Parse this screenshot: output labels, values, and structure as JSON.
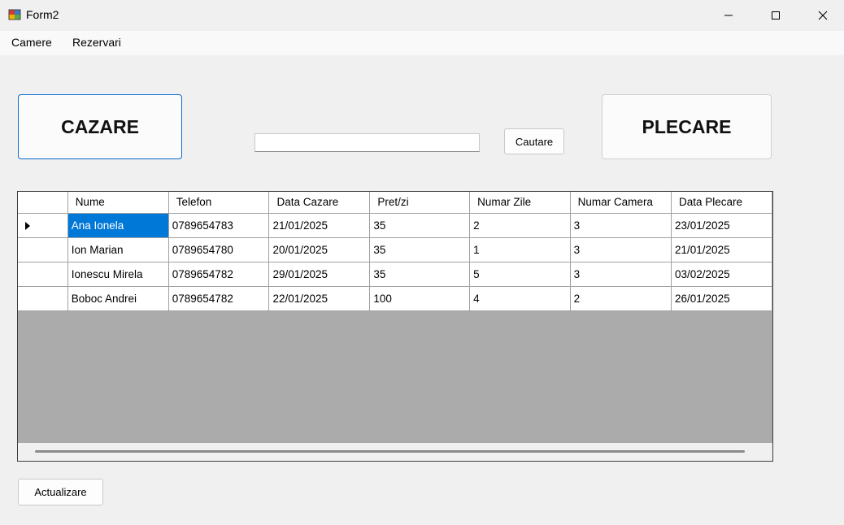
{
  "window": {
    "title": "Form2",
    "controls": {
      "minimize": "minimize-icon",
      "maximize": "maximize-icon",
      "close": "close-icon"
    }
  },
  "menu": {
    "items": [
      "Camere",
      "Rezervari"
    ]
  },
  "actions": {
    "checkin_label": "CAZARE",
    "checkout_label": "PLECARE",
    "search_value": "",
    "search_button_label": "Cautare",
    "refresh_label": "Actualizare"
  },
  "grid": {
    "columns": [
      "Nume",
      "Telefon",
      "Data Cazare",
      "Pret/zi",
      "Numar Zile",
      "Numar Camera",
      "Data Plecare"
    ],
    "rows": [
      [
        "Ana Ionela",
        "0789654783",
        "21/01/2025",
        "35",
        "2",
        "3",
        "23/01/2025"
      ],
      [
        "Ion Marian",
        "0789654780",
        "20/01/2025",
        "35",
        "1",
        "3",
        "21/01/2025"
      ],
      [
        "Ionescu Mirela",
        "0789654782",
        "29/01/2025",
        "35",
        "5",
        "3",
        "03/02/2025"
      ],
      [
        "Boboc Andrei",
        "0789654782",
        "22/01/2025",
        "100",
        "4",
        "2",
        "26/01/2025"
      ]
    ],
    "selected_row": 0
  },
  "colors": {
    "selection": "#0078d7",
    "focus_border": "#0a6cd0",
    "empty_grid": "#ababab"
  }
}
